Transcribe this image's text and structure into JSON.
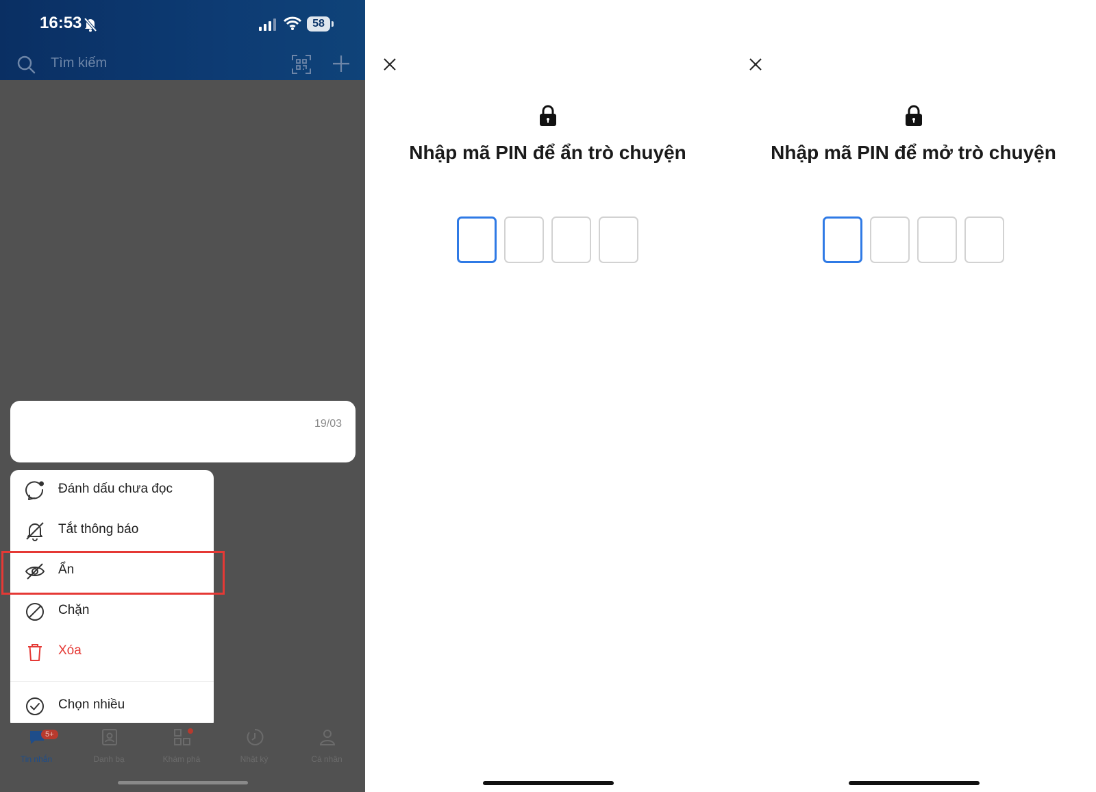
{
  "phone": {
    "status": {
      "time": "16:53",
      "battery": "58"
    },
    "search": {
      "placeholder": "Tìm kiếm"
    },
    "chat": {
      "date": "19/03"
    },
    "context_menu": {
      "items": [
        {
          "label": "Đánh dấu chưa đọc",
          "icon": "unread-chat-icon"
        },
        {
          "label": "Tắt thông báo",
          "icon": "bell-off-icon"
        },
        {
          "label": "Ẩn",
          "icon": "eye-off-icon",
          "highlighted": true
        },
        {
          "label": "Chặn",
          "icon": "block-icon"
        },
        {
          "label": "Xóa",
          "icon": "trash-icon",
          "color": "#e53935"
        },
        {
          "label": "Chọn nhiều",
          "icon": "check-circle-icon"
        }
      ]
    },
    "tabs": [
      {
        "label": "Tin nhắn",
        "icon": "chat-icon",
        "badge": "5+",
        "active": true
      },
      {
        "label": "Danh bạ",
        "icon": "contacts-icon"
      },
      {
        "label": "Khám phá",
        "icon": "grid-icon",
        "dot": true
      },
      {
        "label": "Nhật ký",
        "icon": "clock-icon"
      },
      {
        "label": "Cá nhân",
        "icon": "person-icon"
      }
    ]
  },
  "pin_hide": {
    "title": "Nhập mã PIN để ẩn trò chuyện",
    "digits": 4
  },
  "pin_unhide": {
    "title": "Nhập mã PIN để mở trò chuyện",
    "digits": 4
  },
  "colors": {
    "header": "#0d3b73",
    "overlay": "#515151",
    "accent": "#2f7ae5",
    "danger": "#e53935"
  }
}
